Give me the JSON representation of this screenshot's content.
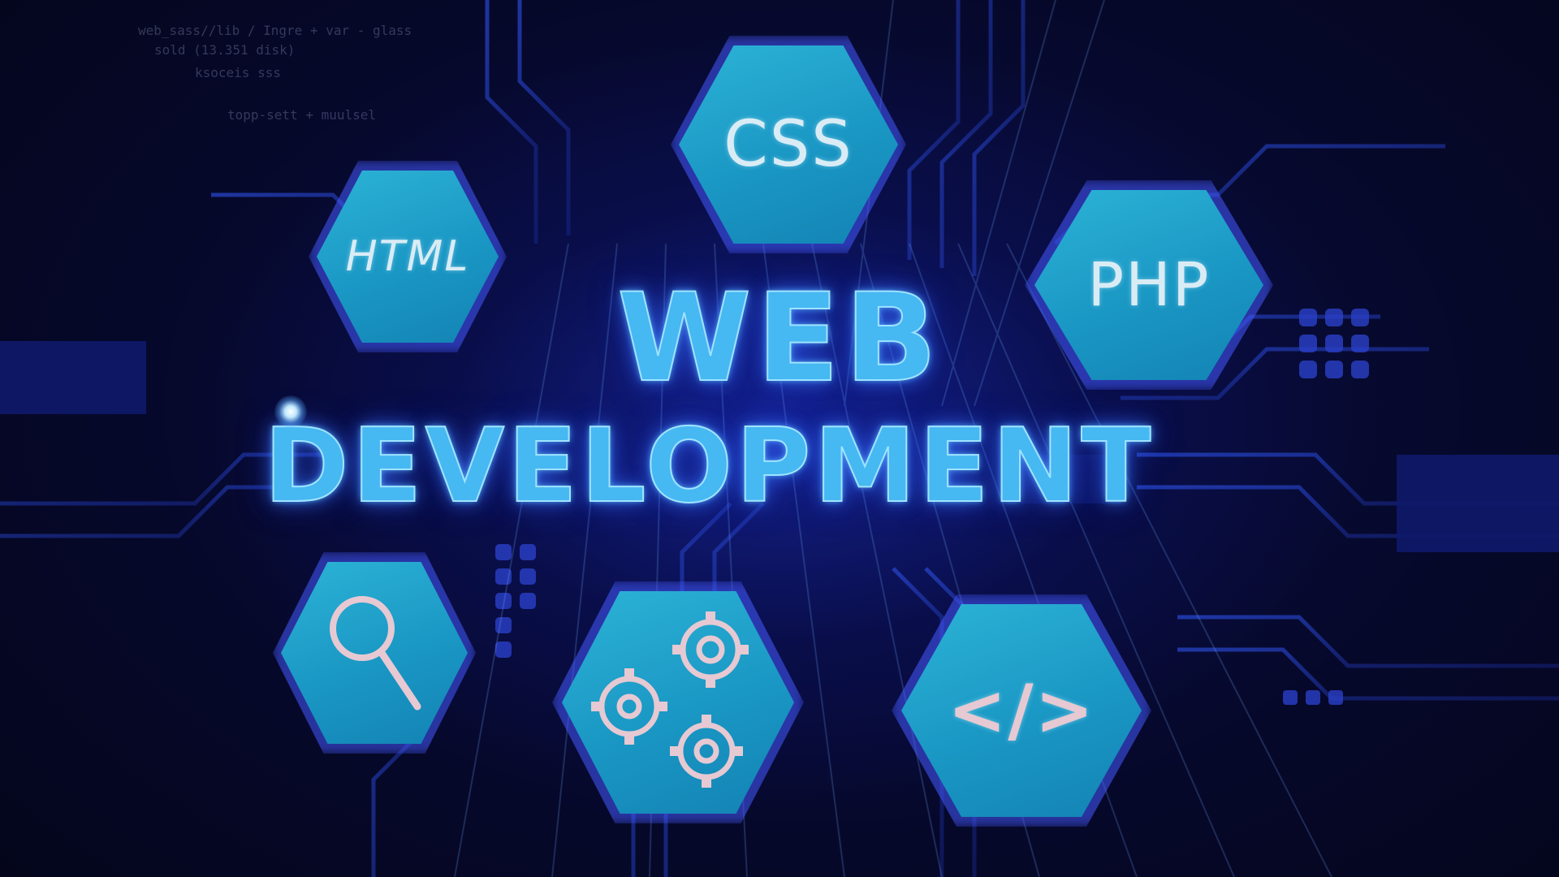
{
  "title": {
    "line1": "WEB",
    "line2": "DEVELOPMENT"
  },
  "hexagons": {
    "html": "HTML",
    "css": "CSS",
    "php": "PHP",
    "search": "search-icon",
    "gears": "gears-icon",
    "code": "</>"
  },
  "background_code": [
    "web_sass//lib / Ingre + var - glass",
    "sold (13.351 disk)",
    "ksoceis sss",
    "topp-sett + muulsel"
  ],
  "colors": {
    "hex_fill": "#1a97c4",
    "title": "#46b8f2",
    "background": "#05061a"
  }
}
